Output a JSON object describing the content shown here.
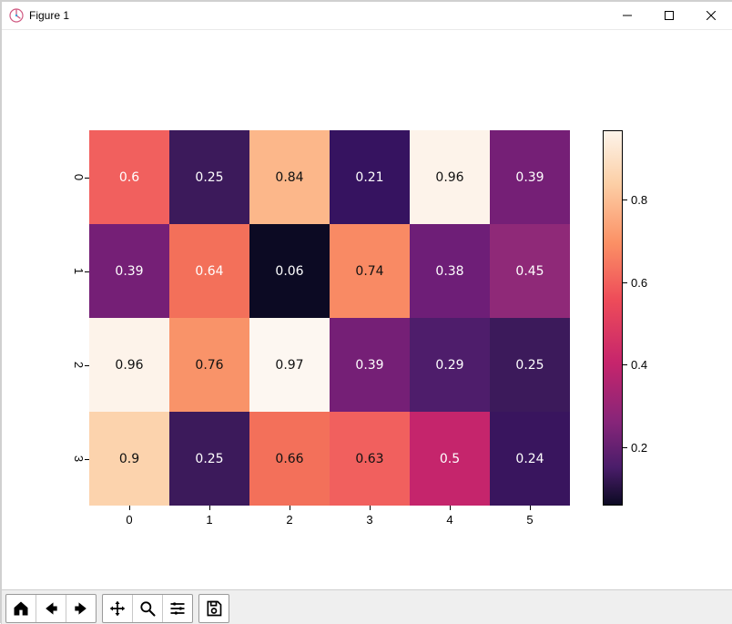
{
  "window": {
    "title": "Figure 1",
    "controls": {
      "minimize_icon": "minimize-icon",
      "maximize_icon": "maximize-icon",
      "close_icon": "close-icon"
    }
  },
  "toolbar": {
    "buttons": [
      {
        "name": "home-icon",
        "label": "Home"
      },
      {
        "name": "back-icon",
        "label": "Back"
      },
      {
        "name": "forward-icon",
        "label": "Forward"
      },
      {
        "name": "pan-icon",
        "label": "Pan"
      },
      {
        "name": "zoom-icon",
        "label": "Zoom"
      },
      {
        "name": "configure-icon",
        "label": "Configure subplots"
      },
      {
        "name": "save-icon",
        "label": "Save"
      }
    ]
  },
  "chart_data": {
    "type": "heatmap",
    "x_labels": [
      "0",
      "1",
      "2",
      "3",
      "4",
      "5"
    ],
    "y_labels": [
      "0",
      "1",
      "2",
      "3"
    ],
    "values": [
      [
        0.6,
        0.25,
        0.84,
        0.21,
        0.96,
        0.39
      ],
      [
        0.39,
        0.64,
        0.06,
        0.74,
        0.38,
        0.45
      ],
      [
        0.96,
        0.76,
        0.97,
        0.39,
        0.29,
        0.25
      ],
      [
        0.9,
        0.25,
        0.66,
        0.63,
        0.5,
        0.24
      ]
    ],
    "cell_text": [
      [
        "0.6",
        "0.25",
        "0.84",
        "0.21",
        "0.96",
        "0.39"
      ],
      [
        "0.39",
        "0.64",
        "0.06",
        "0.74",
        "0.38",
        "0.45"
      ],
      [
        "0.96",
        "0.76",
        "0.97",
        "0.39",
        "0.29",
        "0.25"
      ],
      [
        "0.9",
        "0.25",
        "0.66",
        "0.63",
        "0.5",
        "0.24"
      ]
    ],
    "cell_fill": [
      [
        "#f1605e",
        "#3c1a5b",
        "#fcb78a",
        "#361360",
        "#fdf3ea",
        "#751f76"
      ],
      [
        "#751f76",
        "#f3705a",
        "#0c0a23",
        "#f98a64",
        "#6e1e77",
        "#8f2978"
      ],
      [
        "#fdf3ea",
        "#f99369",
        "#fdf7f1",
        "#751f76",
        "#4e1d6b",
        "#3c1a5b"
      ],
      [
        "#fcd3ad",
        "#3c1a5b",
        "#f3705a",
        "#f1605e",
        "#c5256c",
        "#39155e"
      ]
    ],
    "cell_text_color": [
      [
        "#fff",
        "#fff",
        "#111",
        "#fff",
        "#111",
        "#fff"
      ],
      [
        "#fff",
        "#fff",
        "#fff",
        "#111",
        "#fff",
        "#fff"
      ],
      [
        "#111",
        "#111",
        "#111",
        "#fff",
        "#fff",
        "#fff"
      ],
      [
        "#111",
        "#fff",
        "#111",
        "#111",
        "#fff",
        "#fff"
      ]
    ],
    "colorbar": {
      "range": [
        0.06,
        0.97
      ],
      "ticks": [
        {
          "value": 0.2,
          "label": "0.2"
        },
        {
          "value": 0.4,
          "label": "0.4"
        },
        {
          "value": 0.6,
          "label": "0.6"
        },
        {
          "value": 0.8,
          "label": "0.8"
        }
      ],
      "colormap": "rocket"
    },
    "title": "",
    "xlabel": "",
    "ylabel": ""
  }
}
